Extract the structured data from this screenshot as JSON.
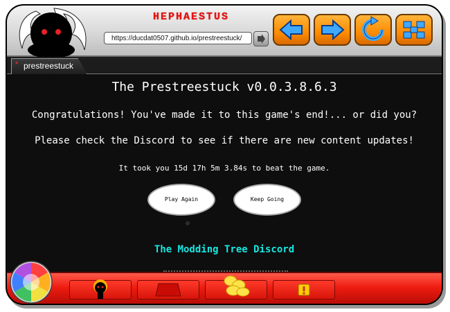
{
  "app": {
    "brand": "HEPHAESTUS",
    "url": "https://ducdat0507.github.io/prestreestuck/"
  },
  "nav": {
    "back_icon": "arrow-left-icon",
    "forward_icon": "arrow-right-icon",
    "refresh_icon": "refresh-icon",
    "home_icon": "grid-icon"
  },
  "tab": {
    "label": "prestreestuck"
  },
  "page": {
    "title": "The Prestreestuck v0.0.3.8.6.3",
    "congrats": "Congratulations! You've made it to this game's end!... or did you?",
    "discord_notice": "Please check the Discord to see if there are new content updates!",
    "time_text": "It took you 15d 17h 5m 3.84s to beat the game.",
    "play_again": "Play Again",
    "keep_going": "Keep Going",
    "discord_link": "The Modding Tree Discord"
  },
  "colors": {
    "accent_orange": "#ff8c00",
    "brand_red": "#e8110f",
    "link_cyan": "#19e6e0",
    "bottom_red": "#ee1b10"
  }
}
